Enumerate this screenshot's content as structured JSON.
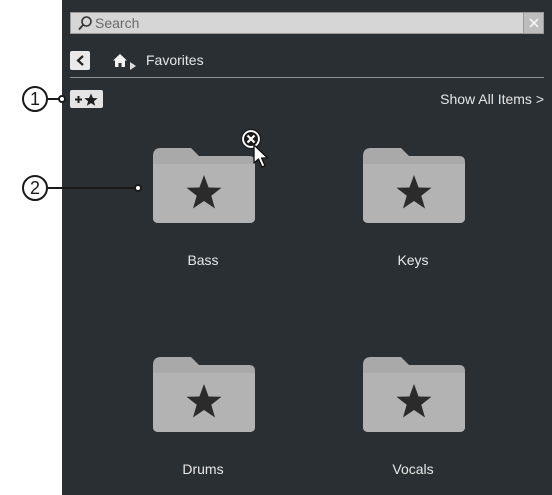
{
  "search": {
    "placeholder": "Search"
  },
  "breadcrumb": {
    "current": "Favorites"
  },
  "toolbar": {
    "show_all_label": "Show All Items >"
  },
  "favorites": [
    {
      "label": "Bass"
    },
    {
      "label": "Keys"
    },
    {
      "label": "Drums"
    },
    {
      "label": "Vocals"
    }
  ],
  "callouts": [
    {
      "number": "1"
    },
    {
      "number": "2"
    }
  ],
  "colors": {
    "panel_bg": "#2a2f33",
    "folder": "#a8a8a8",
    "star": "#2b2b2b"
  },
  "icons": {
    "search": "search-icon",
    "clear": "close-icon",
    "back": "chevron-left-icon",
    "home": "home-icon",
    "add_favorite": "add-favorite-star-icon",
    "folder": "folder-star-icon",
    "remove": "remove-x-icon",
    "cursor": "mouse-cursor-icon"
  }
}
